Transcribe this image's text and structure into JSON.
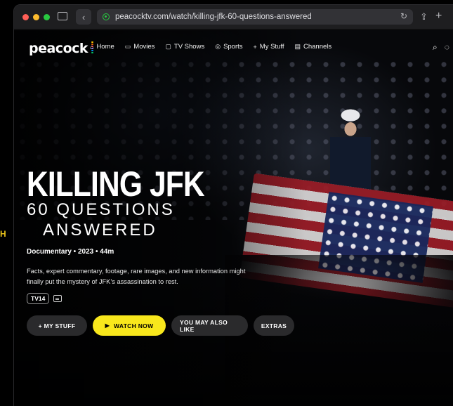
{
  "edge_letter": "H",
  "browser": {
    "url": "peacocktv.com/watch/killing-jfk-60-questions-answered",
    "traffic_lights": [
      "#ff5f57",
      "#febc2e",
      "#28c840"
    ],
    "icons": [
      "sidebar-icon",
      "back-icon",
      "reload-icon",
      "share-icon",
      "new-tab-icon"
    ]
  },
  "nav": {
    "logo": "peacock",
    "logo_dot_colors": [
      "#fdc600",
      "#ff6f00",
      "#f0283c",
      "#6e55dc",
      "#0091f0",
      "#00c864"
    ],
    "items": [
      {
        "label": "Home",
        "icon": "home-icon"
      },
      {
        "label": "Movies",
        "icon": "movies-icon"
      },
      {
        "label": "TV Shows",
        "icon": "tv-icon"
      },
      {
        "label": "Sports",
        "icon": "sports-icon"
      },
      {
        "label": "My Stuff",
        "icon": "plus-icon"
      },
      {
        "label": "Channels",
        "icon": "channels-icon"
      }
    ],
    "right_icons": [
      "search-icon",
      "profile-icon"
    ]
  },
  "hero": {
    "title": "KILLING JFK",
    "subtitle_line1": "60 QUESTIONS",
    "subtitle_line2": "ANSWERED",
    "meta": "Documentary • 2023 • 44m",
    "description": "Facts, expert commentary, footage, rare images, and new information might finally put the mystery of JFK’s assassination to rest.",
    "rating": "TV14",
    "accent": "#f8e71c"
  },
  "actions": {
    "my_stuff": "+ MY STUFF",
    "watch_now": "WATCH NOW",
    "also_like": "YOU MAY ALSO LIKE",
    "extras": "EXTRAS"
  }
}
